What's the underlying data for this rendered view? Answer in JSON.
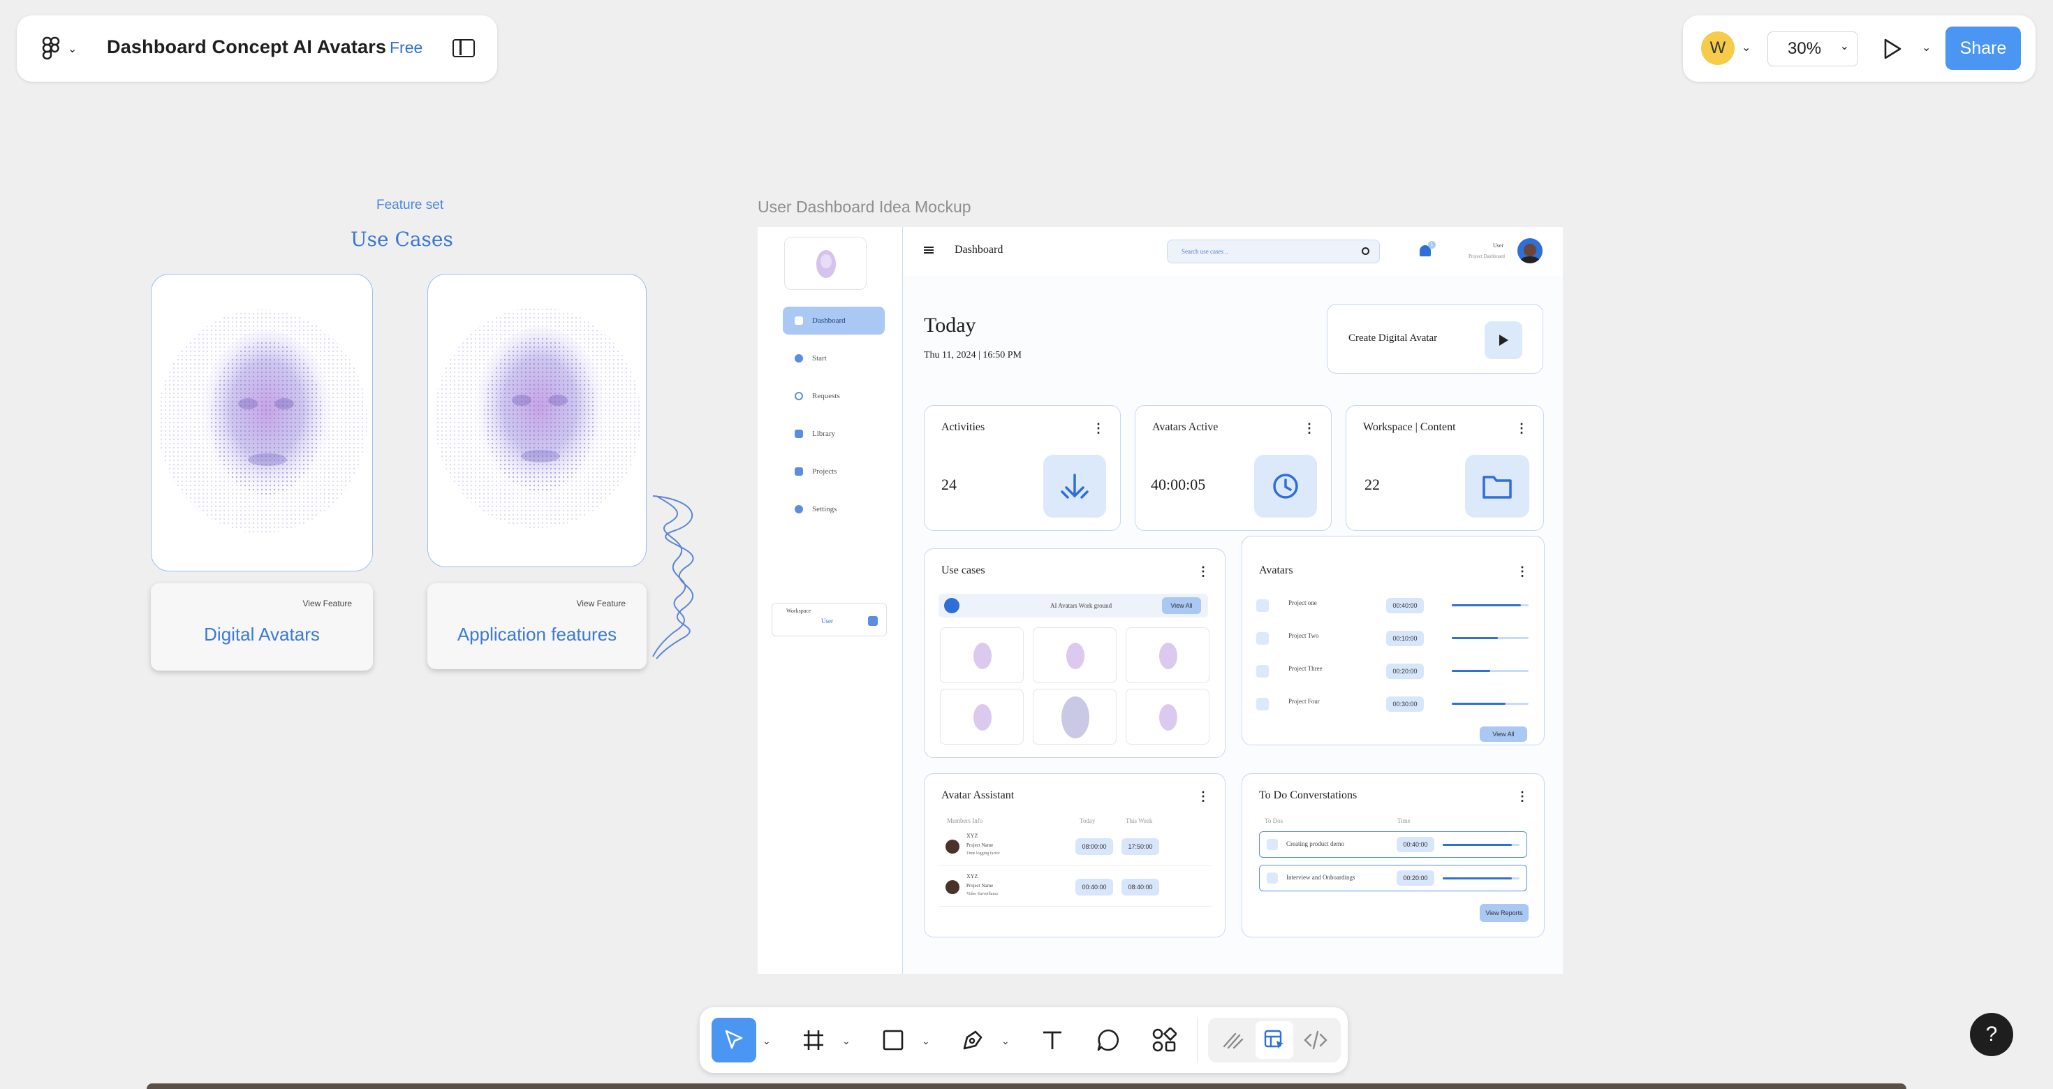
{
  "topbar": {
    "file_title": "Dashboard Concept AI Avatars",
    "plan_badge": "Free",
    "user_initial": "W",
    "zoom": "30%",
    "share_label": "Share"
  },
  "feature_set": {
    "kicker": "Feature set",
    "title": "Use Cases",
    "cards": [
      {
        "view_label": "View Feature",
        "label": "Digital Avatars"
      },
      {
        "view_label": "View Feature",
        "label": "Application features"
      }
    ]
  },
  "mockup": {
    "frame_label": "User Dashboard Idea Mockup",
    "header": {
      "title": "Dashboard",
      "search_placeholder": "Search use cases ..",
      "user_name": "User",
      "user_sub": "Project Dashboard",
      "notif_count": "1"
    },
    "nav": [
      "Dashboard",
      "Start",
      "Requests",
      "Library",
      "Projects",
      "Settings"
    ],
    "workspace": {
      "label": "Workspace",
      "value": "User"
    },
    "today": {
      "title": "Today",
      "date": "Thu 11, 2024 | 16:50 PM"
    },
    "create_button": "Create Digital Avatar",
    "stats": [
      {
        "title": "Activities",
        "value": "24"
      },
      {
        "title": "Avatars Active",
        "value": "40:00:05"
      },
      {
        "title": "Workspace | Content",
        "value": "22"
      }
    ],
    "use_cases": {
      "title": "Use cases",
      "banner": "AI Avatars Work ground",
      "view_all": "View All"
    },
    "avatars": {
      "title": "Avatars",
      "rows": [
        {
          "name": "Project one",
          "time": "00:40:00",
          "progress": 0.9
        },
        {
          "name": "Project Two",
          "time": "00:10:00",
          "progress": 0.6
        },
        {
          "name": "Project Three",
          "time": "00:20:00",
          "progress": 0.5
        },
        {
          "name": "Project Four",
          "time": "00:30:00",
          "progress": 0.7
        }
      ],
      "view_all": "View All"
    },
    "assistant": {
      "title": "Avatar Assistant",
      "columns": [
        "Members Info",
        "Today",
        "This Week"
      ],
      "rows": [
        {
          "name": "XYZ",
          "role": "Project Name",
          "desc": "Time logging factor",
          "today": "08:00:00",
          "week": "17:50:00"
        },
        {
          "name": "XYZ",
          "role": "Project Name",
          "desc": "Video Surveillance",
          "today": "00:40:00",
          "week": "08:40:00"
        }
      ]
    },
    "todo": {
      "title": "To Do Converstations",
      "columns": [
        "To Dos",
        "Time"
      ],
      "rows": [
        {
          "name": "Creating product demo",
          "time": "00:40:00",
          "progress": 0.9
        },
        {
          "name": "Interview and Onboardings",
          "time": "00:20:00",
          "progress": 0.9
        }
      ],
      "view_reports": "View Reports"
    }
  },
  "help_label": "?"
}
